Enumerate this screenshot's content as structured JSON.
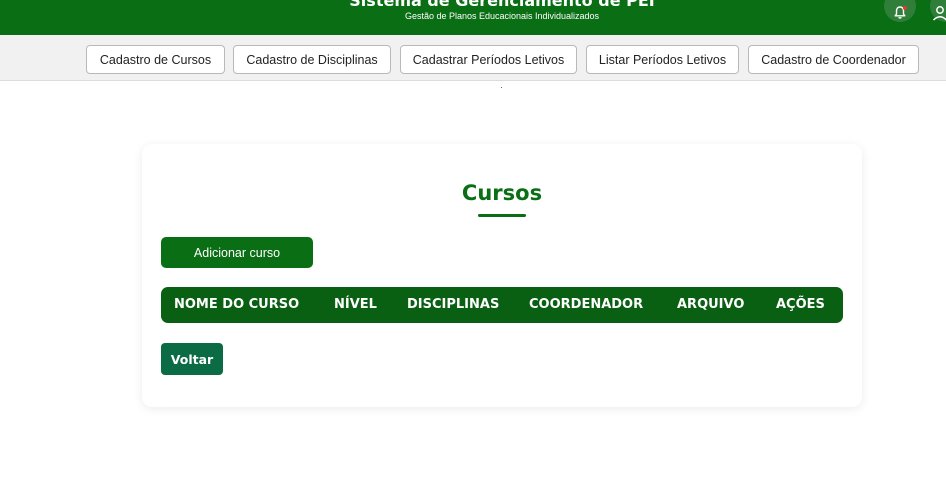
{
  "header": {
    "title": "Sistema de Gerenciamento de PEI",
    "subtitle": "Gestão de Planos Educacionais Individualizados",
    "icons": [
      "bell-icon",
      "user-icon"
    ]
  },
  "nav": {
    "items": [
      {
        "label": "Cadastro de Cursos"
      },
      {
        "label": "Cadastro de Disciplinas"
      },
      {
        "label": "Cadastrar Períodos Letivos"
      },
      {
        "label": "Listar Períodos Letivos"
      },
      {
        "label": "Cadastro de Coordenador"
      }
    ]
  },
  "main": {
    "title": "Cursos",
    "add_button": "Adicionar curso",
    "table": {
      "columns": [
        "NOME DO CURSO",
        "NÍVEL",
        "DISCIPLINAS",
        "COORDENADOR",
        "ARQUIVO",
        "AÇÕES"
      ],
      "rows": []
    },
    "back_button": "Voltar"
  },
  "colors": {
    "brand_green": "#0a6e14",
    "table_header": "#0a6012",
    "back_button": "#0b6b45"
  }
}
